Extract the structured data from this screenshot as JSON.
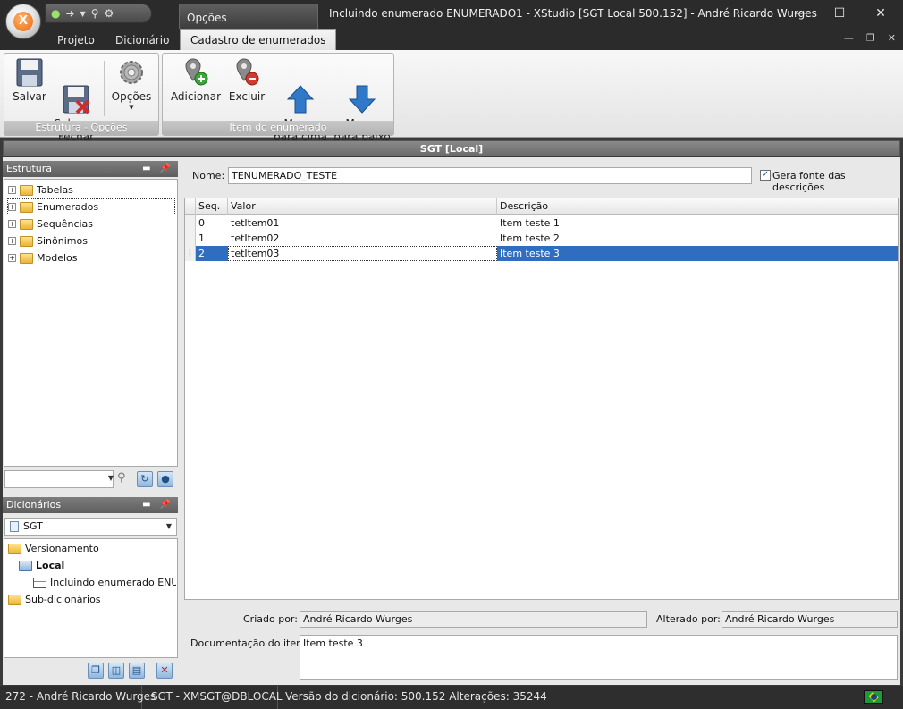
{
  "window": {
    "title": "Incluindo enumerado ENUMERADO1 - XStudio [SGT Local 500.152] - André Ricardo Wurges",
    "context_tab_group": "Opções",
    "app_logo": "X"
  },
  "ribbon": {
    "tabs": [
      {
        "label": "Projeto"
      },
      {
        "label": "Dicionário"
      },
      {
        "label": "Cadastro de enumerados"
      }
    ],
    "groups": [
      {
        "caption": "Estrutura - Opções",
        "buttons": [
          {
            "label": "Salvar",
            "icon": "floppy-disk-icon"
          },
          {
            "label": "Salvar e\nFechar",
            "icon": "floppy-disk-close-icon"
          },
          {
            "label": "Opções",
            "icon": "gear-icon"
          }
        ]
      },
      {
        "caption": "Item do enumerado",
        "buttons": [
          {
            "label": "Adicionar",
            "icon": "add-pin-icon"
          },
          {
            "label": "Excluir",
            "icon": "remove-pin-icon"
          },
          {
            "label": "Mover\npara cima",
            "icon": "arrow-up-icon"
          },
          {
            "label": "Mover\npara baixo",
            "icon": "arrow-down-icon"
          }
        ]
      }
    ],
    "colors": {
      "up_arrow": "#2f79c8",
      "down_arrow": "#2f79c8",
      "add": "#3aa635",
      "remove": "#d23a2a"
    }
  },
  "main_title": "SGT [Local]",
  "estrutura": {
    "title": "Estrutura",
    "items": [
      {
        "label": "Tabelas"
      },
      {
        "label": "Enumerados"
      },
      {
        "label": "Sequências"
      },
      {
        "label": "Sinônimos"
      },
      {
        "label": "Modelos"
      }
    ],
    "search_value": ""
  },
  "dicionarios": {
    "title": "Dicionários",
    "selected": "SGT",
    "tree": [
      {
        "label": "Versionamento"
      },
      {
        "label": "Local"
      },
      {
        "label": "Incluindo enumerado ENUMER"
      },
      {
        "label": "Sub-dicionários"
      }
    ]
  },
  "form": {
    "nome_label": "Nome:",
    "nome_value": "TENUMERADO_TESTE",
    "gera_fonte_label": "Gera fonte das descrições",
    "gera_fonte_checked": true,
    "grid": {
      "columns": [
        "Seq.",
        "Valor",
        "Descrição"
      ],
      "rows": [
        {
          "seq": "0",
          "valor": "tetItem01",
          "descricao": "Item teste 1"
        },
        {
          "seq": "1",
          "valor": "tetItem02",
          "descricao": "Item teste 2"
        },
        {
          "seq": "2",
          "valor": "tetItem03",
          "descricao": "Item teste 3"
        }
      ],
      "selected_indicator": "I"
    },
    "criado_por_label": "Criado por:",
    "criado_por_value": "André Ricardo Wurges",
    "alterado_por_label": "Alterado por:",
    "alterado_por_value": "André Ricardo Wurges",
    "documentacao_label": "Documentação do item:",
    "documentacao_value": "Item teste 3"
  },
  "statusbar": {
    "user": "272 - André Ricardo Wurges",
    "connection": "SGT - XMSGT@DBLOCAL",
    "version": "Versão do dicionário: 500.152 Alterações: 35244"
  }
}
